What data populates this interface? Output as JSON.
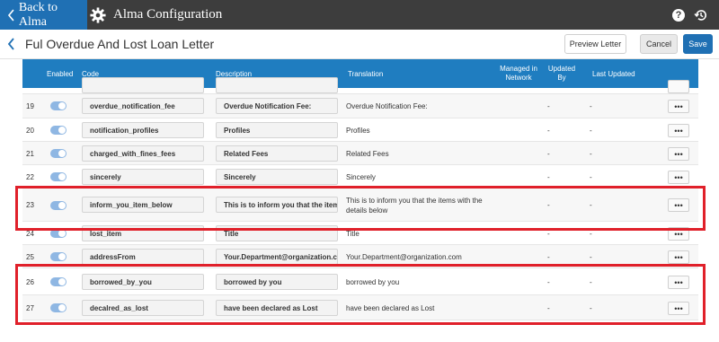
{
  "topbar": {
    "back_label": "Back to Alma",
    "app_title": "Alma Configuration",
    "help_glyph": "?"
  },
  "header": {
    "title": "Ful Overdue And Lost Loan Letter",
    "preview_label": "Preview Letter",
    "cancel_label": "Cancel",
    "save_label": "Save"
  },
  "table": {
    "headers": {
      "enabled": "Enabled",
      "code": "Code",
      "description": "Description",
      "translation": "Translation",
      "managed_in_network": "Managed in Network",
      "updated_by": "Updated By",
      "last_updated": "Last Updated"
    },
    "more_glyph": "•••",
    "rows": [
      {
        "num": "19",
        "code": "overdue_notification_fee",
        "description": "Overdue Notification Fee:",
        "translation": "Overdue Notification Fee:",
        "updated_by": "-",
        "last_updated": "-"
      },
      {
        "num": "20",
        "code": "notification_profiles",
        "description": "Profiles",
        "translation": "Profiles",
        "updated_by": "-",
        "last_updated": "-"
      },
      {
        "num": "21",
        "code": "charged_with_fines_fees",
        "description": "Related Fees",
        "translation": "Related Fees",
        "updated_by": "-",
        "last_updated": "-"
      },
      {
        "num": "22",
        "code": "sincerely",
        "description": "Sincerely",
        "translation": "Sincerely",
        "updated_by": "-",
        "last_updated": "-"
      },
      {
        "num": "23",
        "code": "inform_you_item_below",
        "description": "This is to inform you that the items with the details below",
        "translation": "This is to inform you that the items with the details below",
        "updated_by": "-",
        "last_updated": "-"
      },
      {
        "num": "24",
        "code": "lost_item",
        "description": "Title",
        "translation": "Title",
        "updated_by": "-",
        "last_updated": "-"
      },
      {
        "num": "25",
        "code": "addressFrom",
        "description": "Your.Department@organization.com",
        "translation": "Your.Department@organization.com",
        "updated_by": "-",
        "last_updated": "-"
      },
      {
        "num": "26",
        "code": "borrowed_by_you",
        "description": "borrowed by you",
        "translation": "borrowed by you",
        "updated_by": "-",
        "last_updated": "-"
      },
      {
        "num": "27",
        "code": "decalred_as_lost",
        "description": "have been declared as Lost",
        "translation": "have been declared as Lost",
        "updated_by": "-",
        "last_updated": "-"
      }
    ]
  },
  "colors": {
    "topbar_bg": "#3d3d3d",
    "brand_blue": "#1f70b4",
    "table_header_blue": "#1f7dc0",
    "highlight_red": "#e0202a",
    "toggle_on": "#8fb7e3"
  },
  "icons": [
    "chevron-left-icon",
    "gear-icon",
    "help-icon",
    "history-icon",
    "more-icon"
  ]
}
